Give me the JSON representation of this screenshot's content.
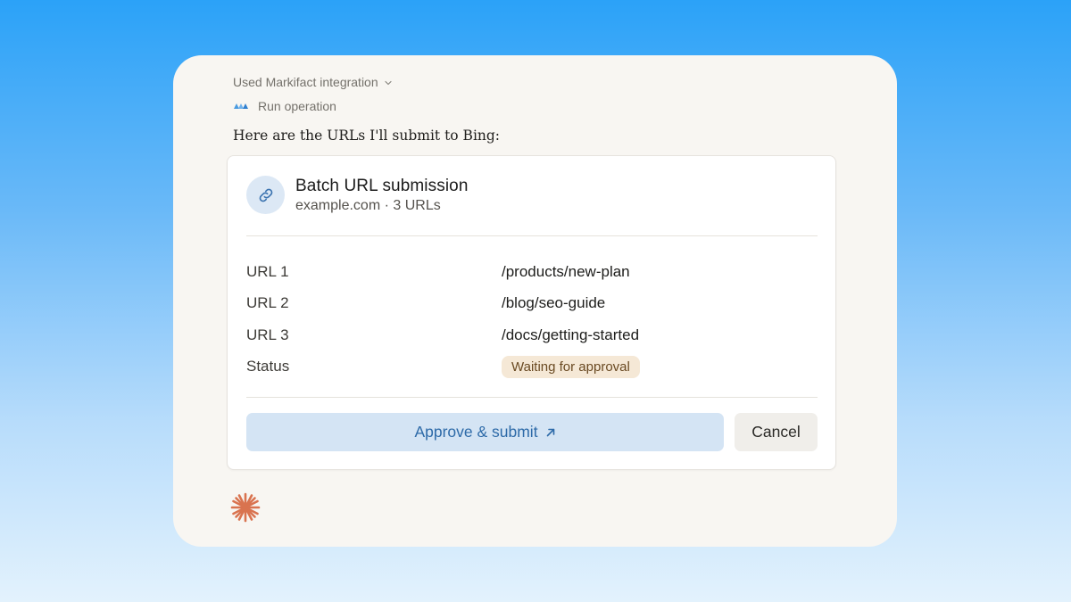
{
  "tool": {
    "used_label": "Used Markifact integration",
    "operation_label": "Run operation"
  },
  "message": "Here are the URLs I'll submit to Bing:",
  "card": {
    "title": "Batch URL submission",
    "subtitle": "example.com · 3 URLs",
    "rows": [
      {
        "label": "URL 1",
        "value": "/products/new-plan"
      },
      {
        "label": "URL 2",
        "value": "/blog/seo-guide"
      },
      {
        "label": "URL 3",
        "value": "/docs/getting-started"
      }
    ],
    "status_label": "Status",
    "status_value": "Waiting for approval",
    "approve_label": "Approve & submit",
    "cancel_label": "Cancel"
  },
  "icons": {
    "chevron": "chevron-down-icon",
    "operation": "markifact-logo-icon",
    "link": "link-icon",
    "external": "arrow-up-right-icon",
    "assistant": "sparkle-icon"
  },
  "colors": {
    "accent": "#2d6aa8",
    "approve_bg": "#d4e4f4",
    "badge_bg": "#f5e8d6",
    "spark": "#d9734f"
  }
}
